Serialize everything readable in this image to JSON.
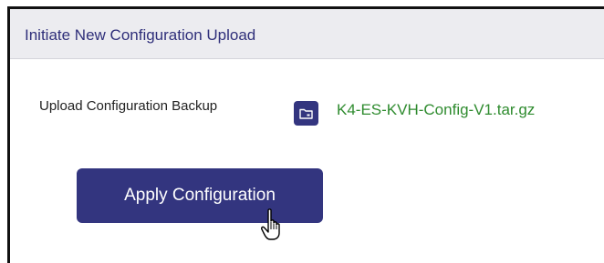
{
  "panel": {
    "title": "Initiate New Configuration Upload"
  },
  "upload": {
    "label": "Upload Configuration Backup",
    "icon": "folder-icon",
    "file_name": "K4-ES-KVH-Config-V1.tar.gz"
  },
  "actions": {
    "apply_label": "Apply Configuration"
  },
  "colors": {
    "accent": "#33357f",
    "header_bg": "#ececf0",
    "header_text": "#2f2f7a",
    "file_text": "#2e8b2e"
  },
  "pointer": {
    "icon": "hand-cursor-icon"
  }
}
